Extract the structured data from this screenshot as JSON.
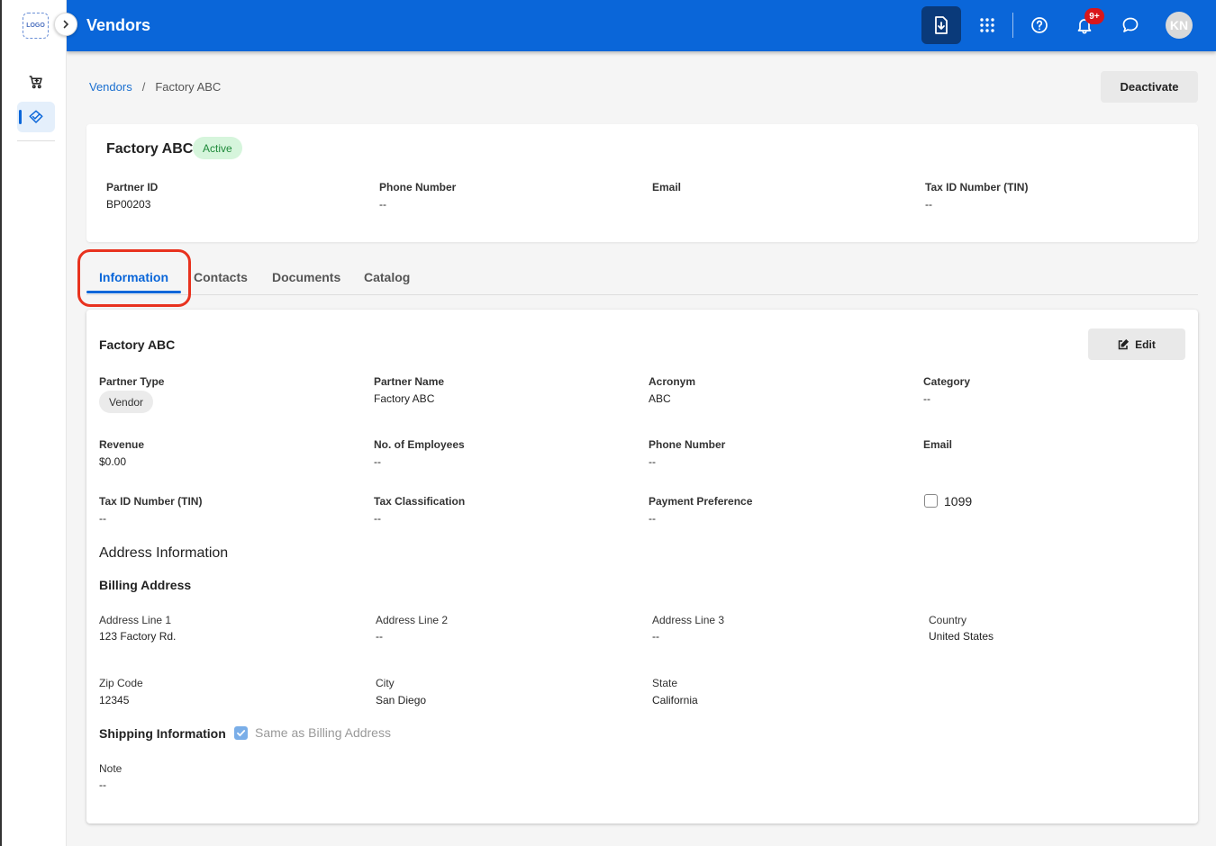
{
  "rail": {
    "logo_text": "LOGO",
    "items": [
      {
        "icon": "cart-icon"
      },
      {
        "icon": "handshake-icon"
      }
    ]
  },
  "topbar": {
    "title": "Vendors",
    "notification_badge": "9+",
    "avatar_initials": "KN"
  },
  "breadcrumb": {
    "parent": "Vendors",
    "separator": "/",
    "current": "Factory ABC"
  },
  "actions": {
    "deactivate": "Deactivate",
    "edit": "Edit"
  },
  "header": {
    "name": "Factory ABC",
    "status": "Active",
    "fields": [
      {
        "label": "Partner ID",
        "value": "BP00203"
      },
      {
        "label": "Phone Number",
        "value": "--"
      },
      {
        "label": "Email",
        "value": ""
      },
      {
        "label": "Tax ID Number (TIN)",
        "value": "--"
      }
    ]
  },
  "tabs": [
    {
      "label": "Information",
      "active": true
    },
    {
      "label": "Contacts"
    },
    {
      "label": "Documents"
    },
    {
      "label": "Catalog"
    }
  ],
  "info": {
    "title": "Factory ABC",
    "partner_type": {
      "label": "Partner Type",
      "value": "Vendor"
    },
    "partner_name": {
      "label": "Partner Name",
      "value": "Factory ABC"
    },
    "acronym": {
      "label": "Acronym",
      "value": "ABC"
    },
    "category": {
      "label": "Category",
      "value": "--"
    },
    "revenue": {
      "label": "Revenue",
      "value": "$0.00"
    },
    "employees": {
      "label": "No. of Employees",
      "value": "--"
    },
    "phone": {
      "label": "Phone Number",
      "value": "--"
    },
    "email": {
      "label": "Email",
      "value": ""
    },
    "tin": {
      "label": "Tax ID Number (TIN)",
      "value": "--"
    },
    "tax_class": {
      "label": "Tax Classification",
      "value": "--"
    },
    "payment": {
      "label": "Payment Preference",
      "value": "--"
    },
    "form_1099": {
      "label": "1099",
      "checked": false
    }
  },
  "address": {
    "section_title": "Address Information",
    "billing_title": "Billing Address",
    "line1": {
      "label": "Address Line 1",
      "value": "123 Factory Rd."
    },
    "line2": {
      "label": "Address Line 2",
      "value": "--"
    },
    "line3": {
      "label": "Address Line 3",
      "value": "--"
    },
    "country": {
      "label": "Country",
      "value": "United States"
    },
    "zip": {
      "label": "Zip Code",
      "value": "12345"
    },
    "city": {
      "label": "City",
      "value": "San Diego"
    },
    "state": {
      "label": "State",
      "value": "California"
    },
    "shipping_title": "Shipping Information",
    "same_as_billing": {
      "label": "Same as Billing Address",
      "checked": true
    },
    "note": {
      "label": "Note",
      "value": "--"
    }
  },
  "colors": {
    "primary": "#0a66d9",
    "highlight": "#e8321e",
    "active_badge_bg": "#d6f5dc",
    "active_badge_text": "#1f8a3a",
    "notification": "#d8161b"
  }
}
